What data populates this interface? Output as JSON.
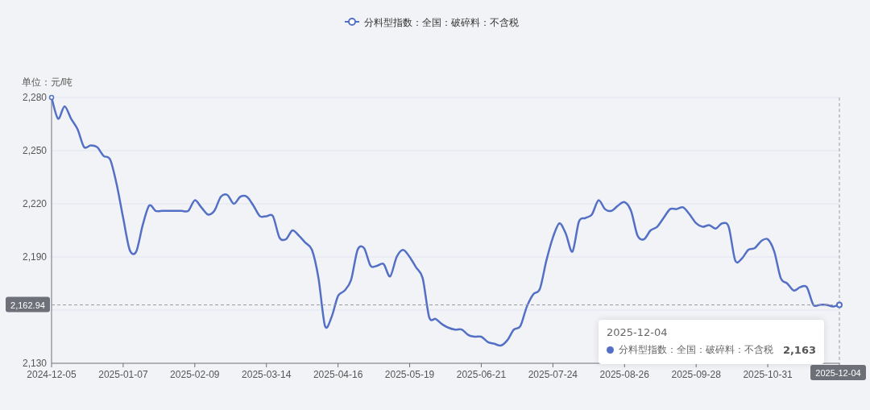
{
  "chart": {
    "chart_data": {
      "type": "line",
      "ylabel": "单位：元/吨",
      "categories": [
        "2024-12-05",
        null,
        null,
        null,
        null,
        null,
        null,
        null,
        null,
        null,
        null,
        "2025-01-07",
        null,
        null,
        null,
        null,
        null,
        null,
        null,
        null,
        null,
        null,
        "2025-02-09",
        null,
        null,
        null,
        null,
        null,
        null,
        null,
        null,
        null,
        null,
        "2025-03-14",
        null,
        null,
        null,
        null,
        null,
        null,
        null,
        null,
        null,
        null,
        "2025-04-16",
        null,
        null,
        null,
        null,
        null,
        null,
        null,
        null,
        null,
        null,
        "2025-05-19",
        null,
        null,
        null,
        null,
        null,
        null,
        null,
        null,
        null,
        null,
        "2025-06-21",
        null,
        null,
        null,
        null,
        null,
        null,
        null,
        null,
        null,
        null,
        "2025-07-24",
        null,
        null,
        null,
        null,
        null,
        null,
        null,
        null,
        null,
        null,
        "2025-08-26",
        null,
        null,
        null,
        null,
        null,
        null,
        null,
        null,
        null,
        null,
        "2025-09-28",
        null,
        null,
        null,
        null,
        null,
        null,
        null,
        null,
        null,
        null,
        "2025-10-31",
        null,
        null,
        null,
        null,
        null,
        null,
        null,
        null,
        null,
        null,
        "2025-12-04"
      ],
      "series": [
        {
          "name": "分料型指数：全国：破碎料：不含税",
          "color": "#5470c6",
          "values": [
            2280,
            2268,
            2275,
            2268,
            2262,
            2252,
            2253,
            2252,
            2247,
            2245,
            2231,
            2212,
            2194,
            2193,
            2208,
            2219,
            2216,
            2216,
            2216,
            2216,
            2216,
            2216,
            2222,
            2218,
            2214,
            2216,
            2224,
            2225,
            2220,
            2224,
            2224,
            2219,
            2213,
            2213,
            2213,
            2201,
            2200,
            2205,
            2202,
            2198,
            2194,
            2178,
            2151,
            2156,
            2168,
            2171,
            2177,
            2194,
            2195,
            2185,
            2185,
            2186,
            2179,
            2190,
            2194,
            2190,
            2184,
            2178,
            2156,
            2155,
            2152,
            2150,
            2149,
            2149,
            2146,
            2145,
            2145,
            2142,
            2141,
            2140,
            2143,
            2149,
            2151,
            2162,
            2169,
            2172,
            2188,
            2201,
            2209,
            2203,
            2193,
            2210,
            2212,
            2214,
            2222,
            2217,
            2216,
            2219,
            2221,
            2216,
            2202,
            2200,
            2205,
            2207,
            2212,
            2217,
            2217,
            2218,
            2214,
            2209,
            2207,
            2208,
            2206,
            2209,
            2207,
            2188,
            2189,
            2194,
            2195,
            2199,
            2200,
            2193,
            2178,
            2175,
            2171,
            2173,
            2173,
            2163,
            2163,
            2163,
            2162,
            2163
          ]
        }
      ],
      "ylim": [
        2130,
        2280
      ],
      "grid": true,
      "ref_lines": [
        {
          "axis": "y",
          "value": 2162.94,
          "label": "2,162.94"
        }
      ],
      "yticks": [
        {
          "value": 2130,
          "label": "2,130"
        },
        {
          "value": 2190,
          "label": "2,190"
        },
        {
          "value": 2220,
          "label": "2,220"
        },
        {
          "value": 2250,
          "label": "2,250"
        },
        {
          "value": 2280,
          "label": "2,280"
        }
      ]
    },
    "tooltip": {
      "title": "2025-12-04",
      "series_name": "分料型指数：全国：破碎料：不含税",
      "value": "2,163"
    }
  }
}
